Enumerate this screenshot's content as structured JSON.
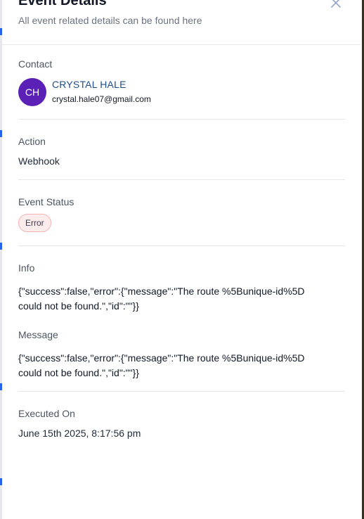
{
  "header": {
    "title": "Event Details",
    "subtitle": "All event related details can be found here"
  },
  "contact": {
    "label": "Contact",
    "initials": "CH",
    "name": "CRYSTAL HALE",
    "email": "crystal.hale07@gmail.com"
  },
  "action": {
    "label": "Action",
    "value": "Webhook"
  },
  "event_status": {
    "label": "Event Status",
    "value": "Error"
  },
  "info": {
    "label": "Info",
    "value": "{\"success\":false,\"error\":{\"message\":\"The route %5Bunique-id%5D could not be found.\",\"id\":\"\"}}"
  },
  "message": {
    "label": "Message",
    "value": "{\"success\":false,\"error\":{\"message\":\"The route %5Bunique-id%5D could not be found.\",\"id\":\"\"}}"
  },
  "executed_on": {
    "label": "Executed On",
    "value": "June 15th 2025, 8:17:56 pm"
  },
  "colors": {
    "avatar_bg": "#5b21b6",
    "contact_link": "#1e4e8c",
    "error_badge_bg": "#fdecec",
    "error_badge_border": "#f5b5b5"
  },
  "icons": {
    "close": "close-icon"
  }
}
